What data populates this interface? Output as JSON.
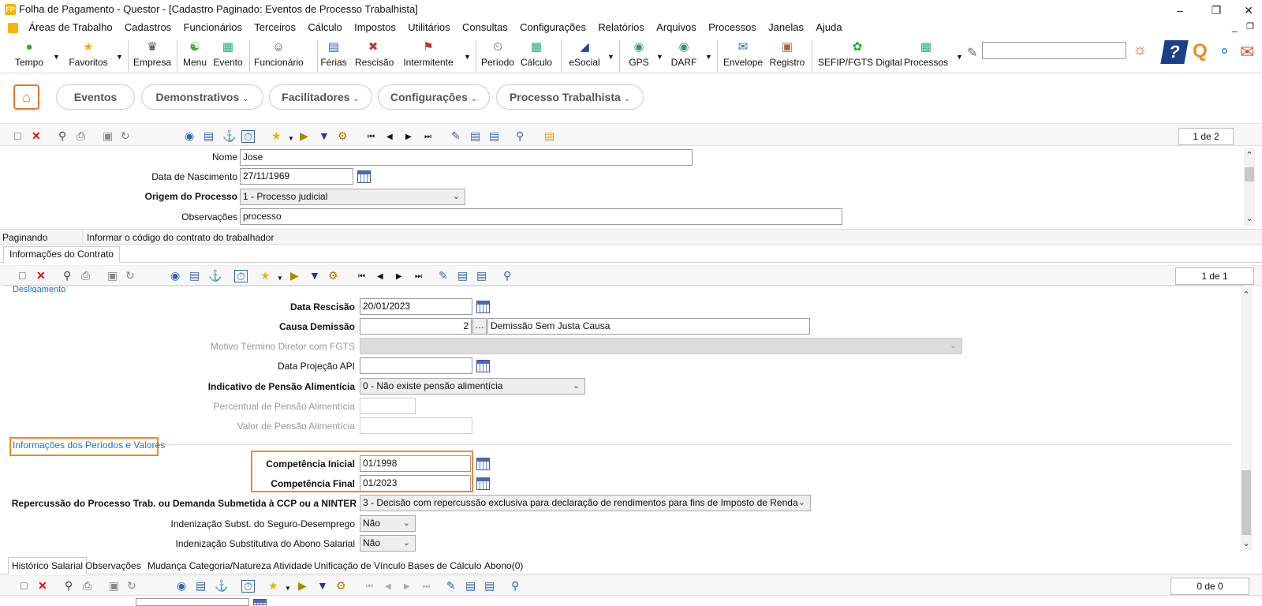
{
  "window": {
    "title": "Folha de Pagamento - Questor - [Cadastro Paginado: Eventos de Processo Trabalhista]",
    "app_icon_text": "FP"
  },
  "menu": [
    "Áreas de Trabalho",
    "Cadastros",
    "Funcionários",
    "Terceiros",
    "Cálculo",
    "Impostos",
    "Utilitários",
    "Consultas",
    "Configurações",
    "Relatórios",
    "Arquivos",
    "Processos",
    "Janelas",
    "Ajuda"
  ],
  "toolbar": {
    "tempo": "Tempo",
    "favoritos": "Favoritos",
    "empresa": "Empresa",
    "menu": "Menu",
    "evento": "Evento",
    "funcionario": "Funcionário",
    "ferias": "Férias",
    "rescisao": "Rescisão",
    "intermitente": "Intermitente",
    "periodo": "Período",
    "calculo": "Cálculo",
    "esocial": "eSocial",
    "gps": "GPS",
    "darf": "DARF",
    "envelope": "Envelope",
    "registro": "Registro",
    "sefip": "SEFIP/FGTS Digital",
    "processos": "Processos",
    "search_value": ""
  },
  "nav": {
    "eventos": "Eventos",
    "demonstrativos": "Demonstrativos",
    "facilitadores": "Facilitadores",
    "configuracoes": "Configurações",
    "processo": "Processo Trabalhista"
  },
  "top_grid": {
    "page": "1 de 2"
  },
  "person": {
    "nome_label": "Nome",
    "nome": "Jose",
    "nasc_label": "Data de Nascimento",
    "nasc": "27/11/1969",
    "origem_label": "Origem do Processo",
    "origem": "1 - Processo judicial",
    "obs_label": "Observações",
    "obs": "processo"
  },
  "status": {
    "mode": "Paginando",
    "hint": "Informar o código do contrato do trabalhador"
  },
  "contract_tab": "Informações do Contrato",
  "contract_grid": {
    "page": "1 de 1"
  },
  "desligamento": {
    "section": "Desligamento",
    "data_rescisao_label": "Data Rescisão",
    "data_rescisao": "20/01/2023",
    "causa_label": "Causa Demissão",
    "causa_code": "2",
    "causa_desc": "Demissão Sem Justa Causa",
    "motivo_label": "Motivo Término Diretor com FGTS",
    "projecao_label": "Data Projeção API",
    "pensao_label": "Indicativo de Pensão Alimentícia",
    "pensao": "0 - Não existe pensão alimentícia",
    "percentual_label": "Percentual de Pensão Alimentícia",
    "valor_label": "Valor de Pensão Alimentícia"
  },
  "periodos": {
    "section": "Informações dos Períodos e Valores",
    "comp_ini_label": "Competência Inicial",
    "comp_ini": "01/1998",
    "comp_fim_label": "Competência Final",
    "comp_fim": "01/2023",
    "repercussao_label": "Repercussão do Processo Trab. ou Demanda Submetida à CCP ou a NINTER",
    "repercussao": "3 - Decisão com repercussão exclusiva para declaração de rendimentos para fins de Imposto de Renda",
    "seguro_label": "Indenização Subst. do Seguro-Desemprego",
    "seguro": "Não",
    "abono_label": "Indenização Substitutiva do Abono Salarial",
    "abono": "Não"
  },
  "bottom_tabs": [
    "Histórico Salarial",
    "Observações",
    "Mudança Categoria/Natureza Atividade",
    "Unificação de Vínculo",
    "Bases de Cálculo",
    "Abono(0)"
  ],
  "bottom_grid": {
    "page": "0 de 0"
  }
}
